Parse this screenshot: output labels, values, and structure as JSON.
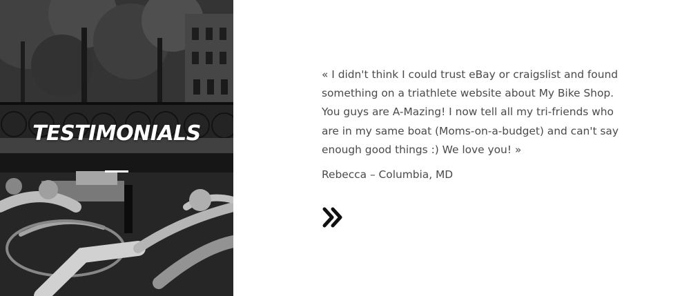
{
  "section": {
    "heading": "TESTIMONIALS",
    "image": "bicycles-on-canal-bridge-photo"
  },
  "testimonial": {
    "quote": "« I didn't think I could trust eBay or craigslist and found something on a triathlete website about My Bike Shop. You guys are A-Mazing! I now tell all my tri-friends who are in my same boat (Moms-on-a-budget) and can't say enough good things :) We love you! »",
    "author": "Rebecca – Columbia, MD"
  },
  "controls": {
    "next_icon": "double-chevron-right-icon"
  },
  "colors": {
    "text": "#4a4a4a",
    "heading": "#ffffff",
    "background": "#ffffff",
    "icon": "#111111"
  }
}
